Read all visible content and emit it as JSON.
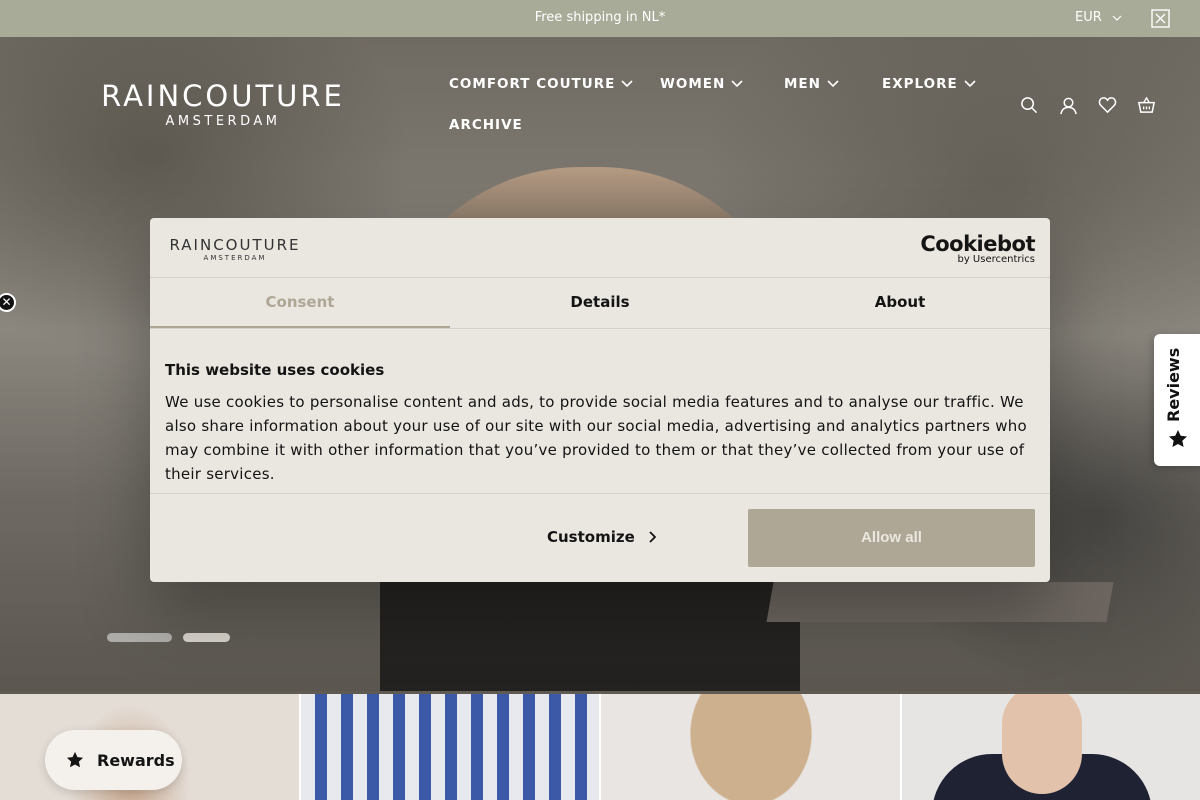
{
  "announcement": {
    "message": "Free shipping in NL*",
    "currency": "EUR"
  },
  "brand": {
    "name": "RAINCOUTURE",
    "sub": "AMSTERDAM"
  },
  "nav": [
    {
      "label": "COMFORT COUTURE"
    },
    {
      "label": "WOMEN"
    },
    {
      "label": "MEN"
    },
    {
      "label": "EXPLORE"
    },
    {
      "label": "ARCHIVE"
    }
  ],
  "header_icons": [
    "search-icon",
    "account-icon",
    "wishlist-icon",
    "cart-icon"
  ],
  "cookie": {
    "logo": "RAINCOUTURE",
    "logo_sub": "AMSTERDAM",
    "provider": "Cookiebot",
    "provider_sub": "by Usercentrics",
    "tabs": [
      "Consent",
      "Details",
      "About"
    ],
    "active_tab": "Consent",
    "title": "This website uses cookies",
    "text": "We use cookies to personalise content and ads, to provide social media features and to analyse our traffic. We also share information about your use of our site with our social media, advertising and analytics partners who may combine it with other information that you’ve provided to them or that they’ve collected from your use of their services.",
    "customize": "Customize",
    "allow": "Allow all"
  },
  "reviews_tab": "Reviews",
  "rewards": "Rewards",
  "colors": {
    "topbar": "#a9ab99",
    "accent": "#aea796",
    "dialog": "#eae6e0"
  }
}
